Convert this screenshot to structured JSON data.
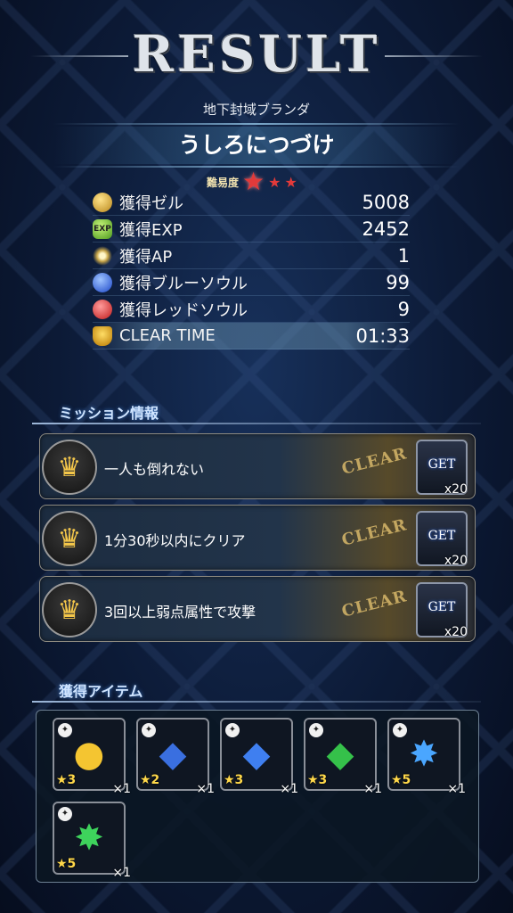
{
  "title": "RESULT",
  "area_name": "地下封域ブランダ",
  "quest_name": "うしろにつづけ",
  "difficulty_label": "難易度",
  "difficulty_stars": 3,
  "rewards": [
    {
      "label": "獲得ゼル",
      "value": "5008",
      "icon": "gil-coin-icon"
    },
    {
      "label": "獲得EXP",
      "value": "2452",
      "icon": "exp-icon"
    },
    {
      "label": "獲得AP",
      "value": "1",
      "icon": "ap-icon"
    },
    {
      "label": "獲得ブルーソウル",
      "value": "99",
      "icon": "blue-soul-icon"
    },
    {
      "label": "獲得レッドソウル",
      "value": "9",
      "icon": "red-soul-icon"
    },
    {
      "label": "CLEAR TIME",
      "value": "01:33",
      "icon": "trophy-icon"
    }
  ],
  "missions_title": "ミッション情報",
  "missions": [
    {
      "text": "一人も倒れない",
      "status": "CLEAR",
      "get_label": "GET",
      "reward_count": "x20"
    },
    {
      "text": "1分30秒以内にクリア",
      "status": "CLEAR",
      "get_label": "GET",
      "reward_count": "x20"
    },
    {
      "text": "3回以上弱点属性で攻撃",
      "status": "CLEAR",
      "get_label": "GET",
      "reward_count": "x20"
    }
  ],
  "items_title": "獲得アイテム",
  "items": [
    {
      "icon": "golden-apple-icon",
      "rarity": "★3",
      "qty": "×1"
    },
    {
      "icon": "blue-crystal-icon",
      "rarity": "★2",
      "qty": "×1"
    },
    {
      "icon": "blue-crystal-icon",
      "rarity": "★3",
      "qty": "×1"
    },
    {
      "icon": "green-crystal-icon",
      "rarity": "★3",
      "qty": "×1"
    },
    {
      "icon": "blue-crystal-cluster-icon",
      "rarity": "★5",
      "qty": "×1"
    },
    {
      "icon": "green-crystal-cluster-icon",
      "rarity": "★5",
      "qty": "×1"
    }
  ],
  "colors": {
    "accent_red": "#e23a3a",
    "gold": "#ffd84a"
  }
}
